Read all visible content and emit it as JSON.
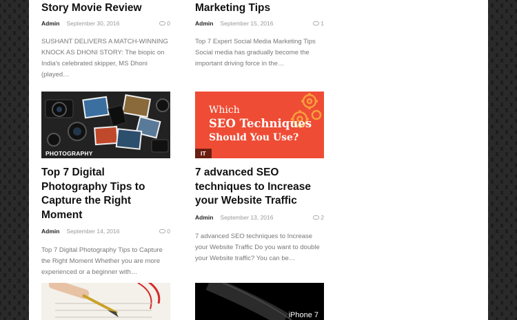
{
  "posts": [
    {
      "title": "Story Movie Review",
      "author": "Admin",
      "date": "September 30, 2016",
      "comments": "0",
      "excerpt": "SUSHANT DELIVERS A MATCH-WINNING KNOCK AS DHONI STORY: The biopic on India's celebrated skipper, MS Dhoni (played…"
    },
    {
      "title": "Marketing Tips",
      "author": "Admin",
      "date": "September 15, 2016",
      "comments": "1",
      "excerpt": "Top 7 Expert Social Media Marketing Tips Social media has gradually become the important driving force in the…"
    },
    {
      "category": "PHOTOGRAPHY",
      "category_color": "#222222",
      "title": "Top 7 Digital Photography Tips to Capture the Right Moment",
      "author": "Admin",
      "date": "September 14, 2016",
      "comments": "0",
      "excerpt": "Top 7 Digital Photography Tips to Capture the Right Moment Whether you are more experienced or a beginner with…"
    },
    {
      "category": "IT",
      "category_color": "#6b1e12",
      "title": "7 advanced SEO techniques to Increase your Website Traffic",
      "author": "Admin",
      "date": "September 13, 2016",
      "comments": "2",
      "excerpt": "7 advanced SEO techniques to Increase your Website Traffic Do you want to double your Website traffic? You can be…",
      "image_text": [
        "Which",
        "SEO Techniques",
        "Should You Use?"
      ]
    },
    {
      "image_icon": "pen-signing-document"
    },
    {
      "image_text": "iPhone 7"
    }
  ],
  "colors": {
    "seo_bg": "#ef4c35",
    "background": "#1a1a1a"
  }
}
